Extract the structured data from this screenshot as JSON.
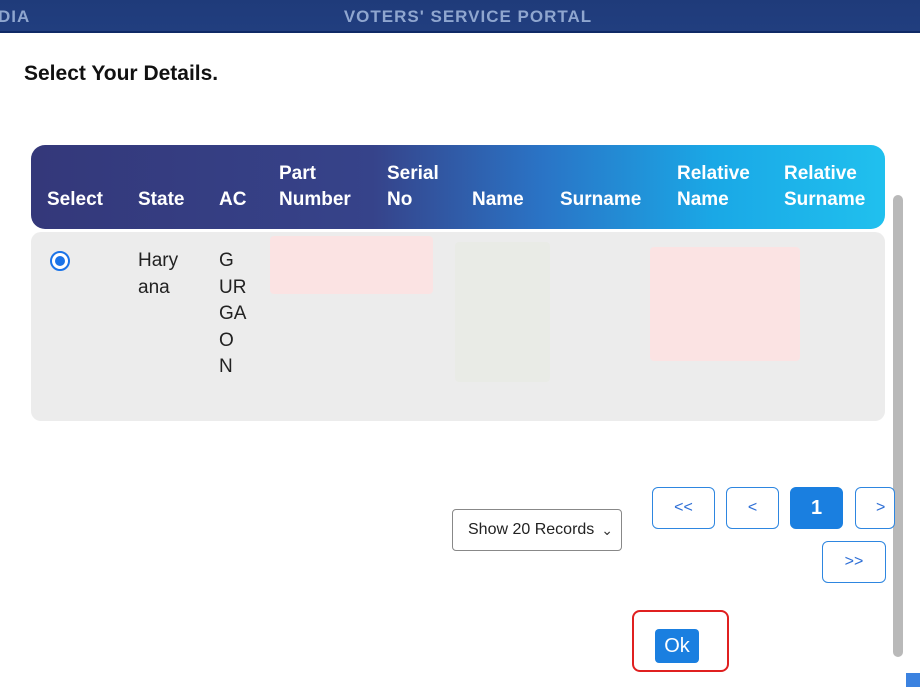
{
  "header": {
    "left_fragment": "DIA",
    "title": "VOTERS' SERVICE PORTAL"
  },
  "page": {
    "heading": "Select Your Details."
  },
  "table": {
    "columns": [
      "Select",
      "State",
      "AC",
      "Part Number",
      "Serial No",
      "Name",
      "Surname",
      "Relative Name",
      "Relative Surname"
    ],
    "rows": [
      {
        "selected": true,
        "state": "Haryana",
        "ac": "GURGAON"
      }
    ]
  },
  "pagination": {
    "records_select": "Show 20 Records",
    "first": "<<",
    "prev": "<",
    "current_page": "1",
    "next": ">",
    "last": ">>"
  },
  "actions": {
    "ok": "Ok"
  },
  "colors": {
    "header_bar": "#213e7f",
    "accent": "#1a7fe0",
    "highlight_outline": "#e02020",
    "row_bg": "#ececec"
  }
}
